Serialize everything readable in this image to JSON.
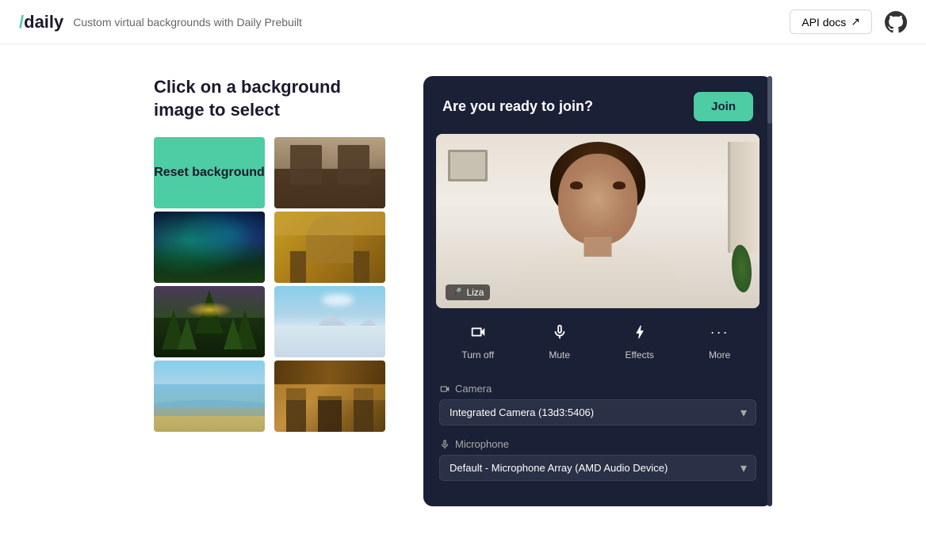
{
  "header": {
    "logo_slash": "/",
    "logo_text": "daily",
    "subtitle": "Custom virtual backgrounds with Daily Prebuilt",
    "api_docs_label": "API docs",
    "external_icon": "↗"
  },
  "left_panel": {
    "title": "Click on a background image to select",
    "reset_label": "Reset background",
    "images": [
      {
        "id": "cafe",
        "alt": "Cafe with tables and chairs"
      },
      {
        "id": "aurora",
        "alt": "Northern lights aurora borealis"
      },
      {
        "id": "dining",
        "alt": "Dining room with chairs"
      },
      {
        "id": "forest",
        "alt": "Forest with pine trees at dusk"
      },
      {
        "id": "mountains",
        "alt": "Snowy mountain peaks"
      },
      {
        "id": "beach",
        "alt": "Beach with ocean waves"
      },
      {
        "id": "market",
        "alt": "Market or restaurant exterior"
      }
    ]
  },
  "right_panel": {
    "join_prompt": "Are you ready to join?",
    "join_button": "Join",
    "participant_name": "Liza",
    "controls": [
      {
        "id": "turn-off",
        "label": "Turn off",
        "icon": "📷"
      },
      {
        "id": "mute",
        "label": "Mute",
        "icon": "🎤"
      },
      {
        "id": "effects",
        "label": "Effects",
        "icon": "✨"
      },
      {
        "id": "more",
        "label": "More",
        "icon": "•••"
      }
    ],
    "camera_label": "Camera",
    "camera_icon": "📷",
    "camera_option": "Integrated Camera (13d3:5406)",
    "microphone_label": "Microphone",
    "microphone_icon": "🎤",
    "microphone_option": "Default - Microphone Array (AMD Audio Device)"
  }
}
